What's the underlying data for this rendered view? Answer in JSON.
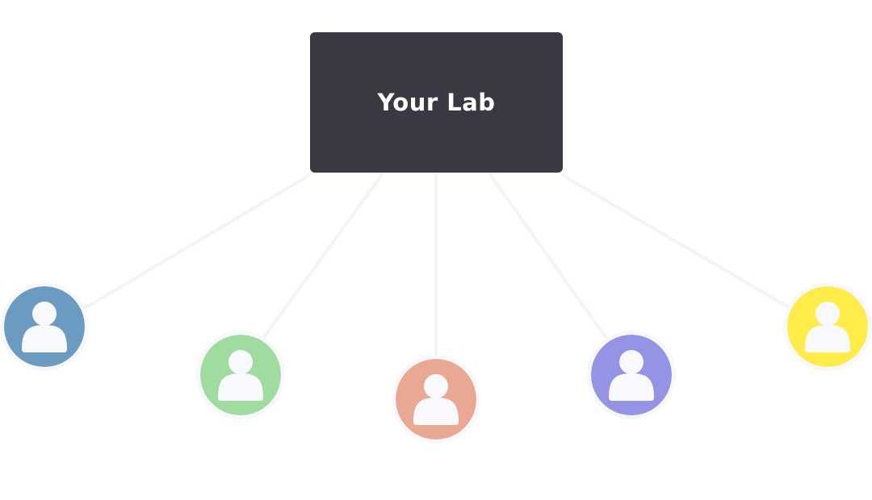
{
  "diagram": {
    "top_caption": "",
    "root": {
      "label": "Your Lab",
      "color": "#393943"
    },
    "nodes": [
      {
        "id": "director",
        "label": "",
        "sublabel": "",
        "color": "#6b9bc0"
      },
      {
        "id": "lab-manager",
        "label": "",
        "sublabel": "",
        "color": "#a0dba0"
      },
      {
        "id": "phd-student",
        "label": "",
        "sublabel": "",
        "color": "#e9a892"
      },
      {
        "id": "research-assistant",
        "label": "",
        "sublabel": "",
        "color": "#9493e6"
      },
      {
        "id": "post-doc",
        "label": "",
        "sublabel": "",
        "color": "#ffeb4a"
      }
    ],
    "icon": "person-icon"
  }
}
